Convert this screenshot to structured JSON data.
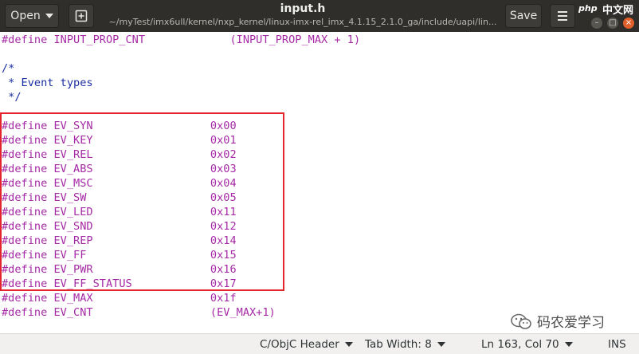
{
  "header": {
    "open_label": "Open",
    "title": "input.h",
    "subtitle": "~/myTest/imx6ull/kernel/nxp_kernel/linux-imx-rel_imx_4.1.15_2.1.0_ga/include/uapi/lin...",
    "save_label": "Save",
    "watermark_php": "php",
    "watermark_cn": "中文网"
  },
  "editor": {
    "lines": [
      "#define INPUT_PROP_CNT             (INPUT_PROP_MAX + 1)",
      "",
      "/*",
      " * Event types",
      " */",
      "",
      "#define EV_SYN                  0x00",
      "#define EV_KEY                  0x01",
      "#define EV_REL                  0x02",
      "#define EV_ABS                  0x03",
      "#define EV_MSC                  0x04",
      "#define EV_SW                   0x05",
      "#define EV_LED                  0x11",
      "#define EV_SND                  0x12",
      "#define EV_REP                  0x14",
      "#define EV_FF                   0x15",
      "#define EV_PWR                  0x16",
      "#define EV_FF_STATUS            0x17",
      "#define EV_MAX                  0x1f",
      "#define EV_CNT                  (EV_MAX+1)"
    ],
    "watermark_text": "码农爱学习"
  },
  "statusbar": {
    "language": "C/ObjC Header",
    "tab_width": "Tab Width: 8",
    "position": "Ln 163, Col 70",
    "mode": "INS"
  }
}
